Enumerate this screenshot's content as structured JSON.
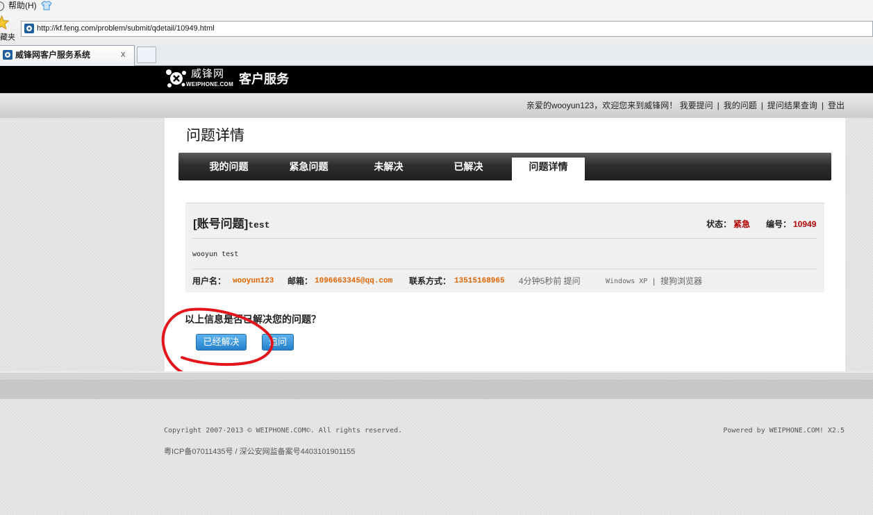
{
  "browser": {
    "menu_help": "帮助(H)",
    "favorites_label": "藏夹",
    "address": "http://kf.feng.com/problem/submit/qdetail/10949.html",
    "tab_title": "威锋网客户服务系统",
    "tab_close": "x"
  },
  "header": {
    "logo_cn": "威锋网",
    "logo_en": "WEIPHONE.COM",
    "service_title": "客户服务"
  },
  "topbar": {
    "welcome": "亲爱的wooyun123，欢迎您来到威锋网！",
    "links": [
      "我要提问",
      "我的问题",
      "提问结果查询",
      "登出"
    ],
    "separator": "|"
  },
  "page": {
    "title": "问题详情",
    "tabs": [
      {
        "label": "我的问题",
        "active": false
      },
      {
        "label": "紧急问题",
        "active": false
      },
      {
        "label": "未解决",
        "active": false
      },
      {
        "label": "已解决",
        "active": false
      },
      {
        "label": "问题详情",
        "active": true
      }
    ]
  },
  "question": {
    "category": "[账号问题]",
    "title": "test",
    "status_label": "状态：",
    "status": "紧急",
    "id_label": "编号：",
    "id": "10949",
    "body": "wooyun test",
    "meta": {
      "username_label": "用户名：",
      "username": "wooyun123",
      "email_label": "邮箱：",
      "email": "1096663345@qq.com",
      "contact_label": "联系方式：",
      "contact": "13515168965",
      "time": "4分钟5秒前 提问",
      "os": "Windows XP",
      "separator": "|",
      "browser": "搜狗浏览器"
    }
  },
  "resolve": {
    "prompt": "以上信息是否已解决您的问题？",
    "resolved_button": "已经解决",
    "followup_button": "追问"
  },
  "footer": {
    "copyright": "Copyright 2007-2013 © WEIPHONE.COM©. All rights reserved.",
    "powered": "Powered by WEIPHONE.COM! X2.5",
    "icp": "粤ICP备07011435号 / 深公安网监备案号4403101901155"
  },
  "colors": {
    "header": "#000000",
    "urgent": "#b00000",
    "info_value": "#e06400",
    "button_top": "#5cb2ee",
    "button_bottom": "#2581cc",
    "annotation": "#e4141b"
  },
  "icons": [
    "shirt-icon",
    "favorites-star-icon",
    "site-favicon",
    "weiphone-logo-icon",
    "new-tab-icon"
  ]
}
